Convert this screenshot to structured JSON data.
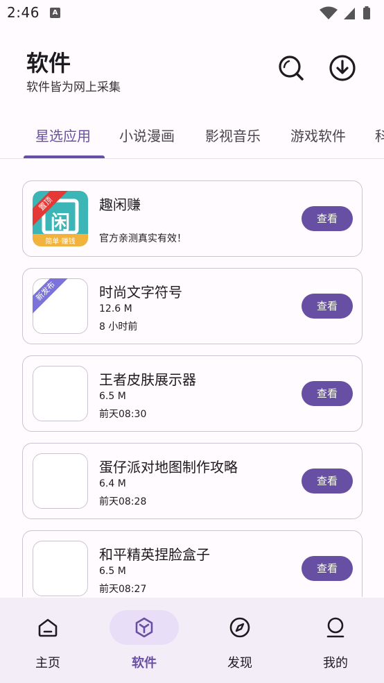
{
  "status_bar": {
    "time": "2:46",
    "notification_glyph": "A"
  },
  "header": {
    "title": "软件",
    "subtitle": "软件皆为网上采集"
  },
  "tabs": [
    {
      "label": "星选应用",
      "active": true
    },
    {
      "label": "小说漫画",
      "active": false
    },
    {
      "label": "影视音乐",
      "active": false
    },
    {
      "label": "游戏软件",
      "active": false
    },
    {
      "label": "科",
      "active": false
    }
  ],
  "apps": [
    {
      "name": "趣闲赚",
      "description": "官方亲测真实有效！",
      "badge": "置顶",
      "badge_color": "#E53935",
      "button": "查看",
      "icon": "quxianzhuan-logo",
      "logo_char": "闲",
      "logo_caption": "简单·赚钱"
    },
    {
      "name": "时尚文字符号",
      "size": "12.6 M",
      "time": "8 小时前",
      "badge": "新发布",
      "badge_color": "#7B73D9",
      "button": "查看"
    },
    {
      "name": "王者皮肤展示器",
      "size": "6.5 M",
      "time": "前天08:30",
      "button": "查看"
    },
    {
      "name": "蛋仔派对地图制作攻略",
      "size": "6.4 M",
      "time": "前天08:28",
      "button": "查看"
    },
    {
      "name": "和平精英捏脸盒子",
      "size": "6.5 M",
      "time": "前天08:27",
      "button": "查看"
    }
  ],
  "bottom_nav": [
    {
      "label": "主页",
      "icon": "home-icon",
      "active": false
    },
    {
      "label": "软件",
      "icon": "cube-icon",
      "active": true
    },
    {
      "label": "发现",
      "icon": "compass-icon",
      "active": false
    },
    {
      "label": "我的",
      "icon": "user-icon",
      "active": false
    }
  ],
  "colors": {
    "primary": "#6750A4",
    "nav_background": "#F3EDF7",
    "nav_active_pill": "#E8DEF8",
    "logo_teal": "#3BB5B5",
    "logo_band": "#F2B33D"
  }
}
